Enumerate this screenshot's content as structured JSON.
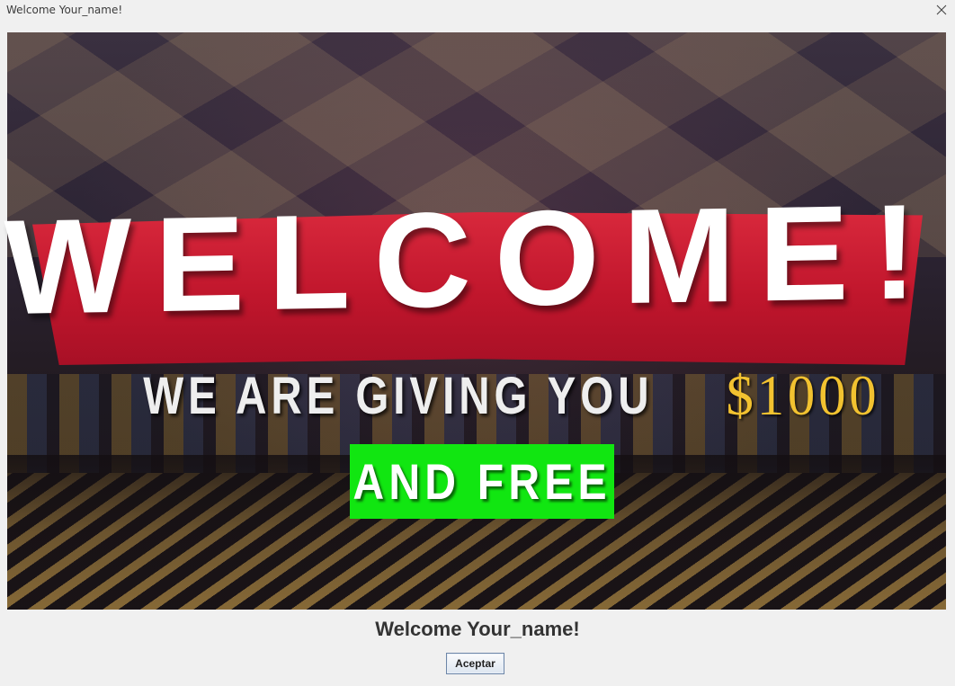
{
  "window": {
    "title": "Welcome Your_name!",
    "close_icon": "close-icon"
  },
  "banner": {
    "headline": "WELCOME!",
    "line2_text": "WE ARE GIVING YOU",
    "amount": "$1000",
    "free_text": "AND FREE",
    "colors": {
      "ribbon": "#c8182f",
      "amount": "#f2c230",
      "free_box": "#11e611"
    }
  },
  "dialog": {
    "message": "Welcome Your_name!",
    "ok_label": "Aceptar"
  }
}
